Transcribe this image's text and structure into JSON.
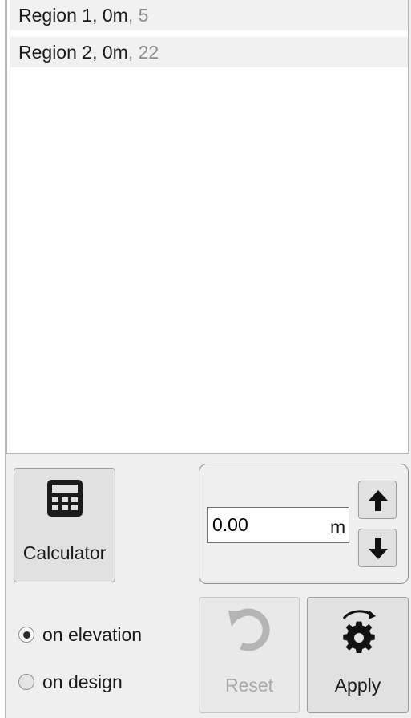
{
  "list": {
    "items": [
      {
        "name": "Region 1, 0m",
        "sep": ", ",
        "count": "5"
      },
      {
        "name": "Region 2, 0m",
        "sep": ", ",
        "count": "22"
      }
    ]
  },
  "calculator": {
    "label": "Calculator",
    "icon": "calculator-icon"
  },
  "offset": {
    "value": "0.00",
    "unit": "m"
  },
  "stepper": {
    "up_icon": "arrow-up-icon",
    "down_icon": "arrow-down-icon"
  },
  "reset": {
    "label": "Reset",
    "icon": "undo-icon",
    "enabled": false
  },
  "apply": {
    "label": "Apply",
    "icon": "gear-apply-icon"
  },
  "mode": {
    "options": [
      {
        "label": "on elevation",
        "selected": true
      },
      {
        "label": "on design",
        "selected": false
      }
    ]
  },
  "colors": {
    "panel_bg": "#efefef",
    "button_bg": "#e1e1e1",
    "disabled_text": "#a8a8a8",
    "count_text": "#8c8c8c"
  }
}
